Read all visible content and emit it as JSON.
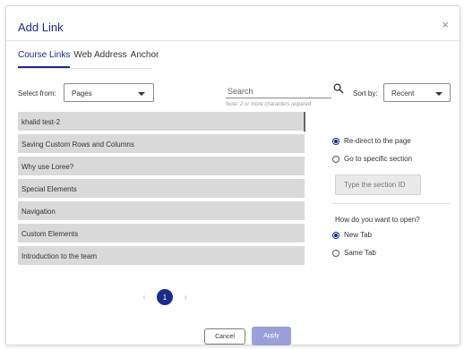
{
  "dialog": {
    "title": "Add Link",
    "close_symbol": "×"
  },
  "tabs": [
    {
      "label": "Course Links",
      "active": true
    },
    {
      "label": "Web Address",
      "active": false
    },
    {
      "label": "Anchor",
      "active": false
    }
  ],
  "filters": {
    "select_from_label": "Select from:",
    "select_from_value": "Pages",
    "search_placeholder": "Search",
    "search_note": "Note: 2 or more characters required",
    "sort_label": "Sort by:",
    "sort_value": "Recent"
  },
  "pages": [
    "khalid test-2",
    "Saving Custom Rows and Columns",
    "Why use Loree?",
    "Special Elements",
    "Navigation",
    "Custom Elements",
    "Introduction to the team"
  ],
  "redirect_options": [
    {
      "label": "Re-direct to the page",
      "checked": true
    },
    {
      "label": "Go to specific section",
      "checked": false
    }
  ],
  "section_id_placeholder": "Type the section ID",
  "open_question": "How do you want to open?",
  "open_options": [
    {
      "label": "New Tab",
      "checked": true
    },
    {
      "label": "Same Tab",
      "checked": false
    }
  ],
  "pagination": {
    "current": "1",
    "prev": "‹",
    "next": "›"
  },
  "footer": {
    "cancel_label": "Cancel",
    "apply_label": "Apply"
  },
  "colors": {
    "primary": "#1a2b8c",
    "apply_bg": "#9b9fd9",
    "list_bg": "#d9d9d9"
  }
}
